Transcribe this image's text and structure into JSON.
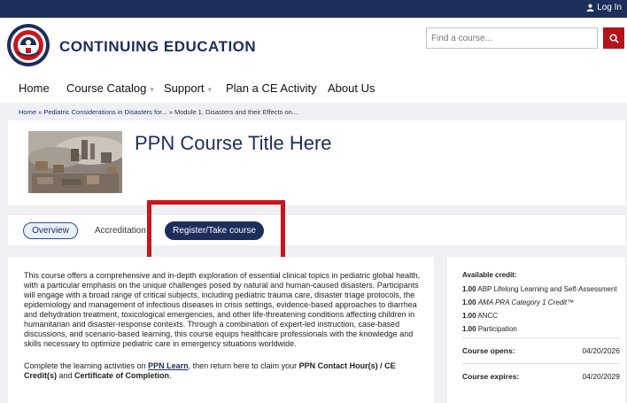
{
  "topbar": {
    "login_label": "Log In"
  },
  "header": {
    "site_title": "CONTINUING EDUCATION",
    "search_placeholder": "Find a course..."
  },
  "nav": {
    "items": [
      {
        "label": "Home"
      },
      {
        "label": "Course Catalog"
      },
      {
        "label": "Support"
      },
      {
        "label": "Plan a CE Activity"
      },
      {
        "label": "About Us"
      }
    ]
  },
  "breadcrumb": {
    "items": [
      "Home",
      "Pediatric Considerations in Disasters for...",
      "Module 1. Disasters and their Effects on..."
    ],
    "separator": "»"
  },
  "course": {
    "title": "PPN Course Title Here"
  },
  "tabs": {
    "overview": "Overview",
    "accreditation": "Accreditation",
    "register": "Register/Take course"
  },
  "description": {
    "paragraph1": "This course offers a comprehensive and in-depth exploration of essential clinical topics in pediatric global health, with a particular emphasis on the unique challenges posed by natural and human-caused disasters. Participants will engage with a broad range of critical subjects, including pediatric trauma care, disaster triage protocols, the epidemiology and management of infectious diseases in crisis settings, evidence-based approaches to diarrhea and dehydration treatment, toxicological emergencies, and other life-threatening conditions affecting children in humanitarian and disaster-response contexts. Through a combination of expert-led instruction, case-based discussions, and scenario-based learning, this course equips healthcare professionals with the knowledge and skills necessary to optimize pediatric care in emergency situations worldwide.",
    "p2_before": "Complete the learning activities on ",
    "p2_link": "PPN Learn",
    "p2_middle": ", then return here to claim your ",
    "p2_bold1": "PPN Contact Hour(s) / CE Credit(s)",
    "p2_and": " and ",
    "p2_bold2": "Certificate of Completion",
    "p2_end": "."
  },
  "credits": {
    "heading": "Available credit:",
    "items": [
      {
        "amount": "1.00",
        "label": "ABP Lifelong Learning and Self-Assessment",
        "italic": false
      },
      {
        "amount": "1.00",
        "label": "AMA PRA Category 1 Credit™",
        "italic": true
      },
      {
        "amount": "1.00",
        "label": "ANCC",
        "italic": false
      },
      {
        "amount": "1.00",
        "label": "Participation",
        "italic": false
      }
    ],
    "opens_label": "Course opens:",
    "opens_date": "04/20/2026",
    "expires_label": "Course expires:",
    "expires_date": "04/20/2029"
  },
  "colors": {
    "brand_navy": "#1d2d5c",
    "search_red": "#b5121b",
    "highlight_red": "#c9151b"
  },
  "icons": {
    "login": "user-icon",
    "search": "search-icon",
    "dropdown": "chevron-down-icon"
  }
}
